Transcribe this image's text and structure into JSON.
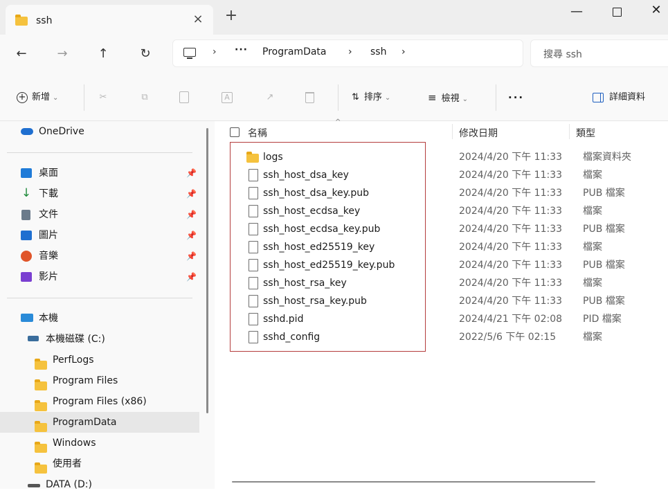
{
  "window": {
    "tab_title": "ssh",
    "tab_close": "×",
    "new_tab": "+",
    "minimize": "—",
    "close": "✕"
  },
  "nav": {
    "back": "←",
    "forward": "→",
    "up": "↑",
    "refresh": "↻"
  },
  "address": {
    "more": "···",
    "separator": "›",
    "crumbs": [
      "ProgramData",
      "ssh"
    ]
  },
  "search": {
    "placeholder": "搜尋 ssh"
  },
  "commands": {
    "new": "新增",
    "cut": "✂",
    "copy": "⧉",
    "paste": "📋",
    "rename": "A",
    "share": "↗",
    "delete": "🗑",
    "sort": "排序",
    "sort_icon": "⇅",
    "view": "檢視",
    "view_icon": "≡",
    "more": "···",
    "details": "詳細資料",
    "caret": "⌄"
  },
  "sidebar": {
    "onedrive": "OneDrive",
    "quick": [
      {
        "label": "桌面",
        "icon": "desktop-icon",
        "color": "#1f7bd8"
      },
      {
        "label": "下載",
        "icon": "download-icon",
        "color": "#1e8a3a"
      },
      {
        "label": "文件",
        "icon": "document-icon",
        "color": "#5b6b7a"
      },
      {
        "label": "圖片",
        "icon": "pictures-icon",
        "color": "#1f6fd0"
      },
      {
        "label": "音樂",
        "icon": "music-icon",
        "color": "#e0552a"
      },
      {
        "label": "影片",
        "icon": "videos-icon",
        "color": "#7a3fd1"
      }
    ],
    "pin": "📌",
    "this_pc": "本機",
    "drive_c": "本機磁碟 (C:)",
    "folders": [
      "PerfLogs",
      "Program Files",
      "Program Files (x86)",
      "ProgramData",
      "Windows",
      "使用者"
    ],
    "selected_folder": "ProgramData",
    "drive_d": "DATA (D:)"
  },
  "columns": {
    "name": "名稱",
    "date": "修改日期",
    "type": "類型",
    "sort_indicator": "^"
  },
  "files": [
    {
      "name": "logs",
      "date": "2024/4/20 下午 11:33",
      "type": "檔案資料夾",
      "kind": "folder"
    },
    {
      "name": "ssh_host_dsa_key",
      "date": "2024/4/20 下午 11:33",
      "type": "檔案",
      "kind": "file"
    },
    {
      "name": "ssh_host_dsa_key.pub",
      "date": "2024/4/20 下午 11:33",
      "type": "PUB 檔案",
      "kind": "file"
    },
    {
      "name": "ssh_host_ecdsa_key",
      "date": "2024/4/20 下午 11:33",
      "type": "檔案",
      "kind": "file"
    },
    {
      "name": "ssh_host_ecdsa_key.pub",
      "date": "2024/4/20 下午 11:33",
      "type": "PUB 檔案",
      "kind": "file"
    },
    {
      "name": "ssh_host_ed25519_key",
      "date": "2024/4/20 下午 11:33",
      "type": "檔案",
      "kind": "file"
    },
    {
      "name": "ssh_host_ed25519_key.pub",
      "date": "2024/4/20 下午 11:33",
      "type": "PUB 檔案",
      "kind": "file"
    },
    {
      "name": "ssh_host_rsa_key",
      "date": "2024/4/20 下午 11:33",
      "type": "檔案",
      "kind": "file"
    },
    {
      "name": "ssh_host_rsa_key.pub",
      "date": "2024/4/20 下午 11:33",
      "type": "PUB 檔案",
      "kind": "file"
    },
    {
      "name": "sshd.pid",
      "date": "2024/4/21 下午 02:08",
      "type": "PID 檔案",
      "kind": "file"
    },
    {
      "name": "sshd_config",
      "date": "2022/5/6 下午 02:15",
      "type": "檔案",
      "kind": "file"
    }
  ],
  "colors": {
    "accent": "#1f5fbf",
    "highlight_border": "#b43c3c",
    "folder": "#f5c23e"
  }
}
